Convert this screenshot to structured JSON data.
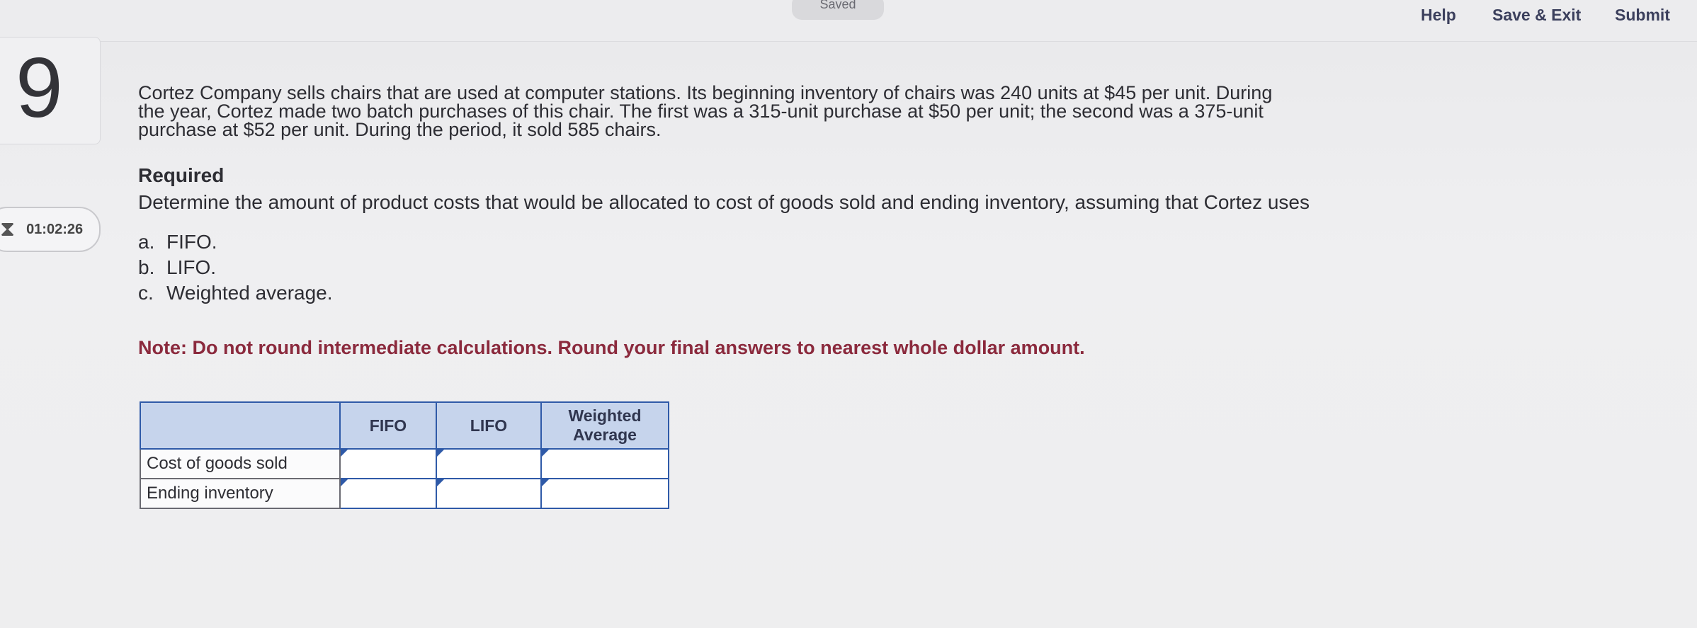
{
  "topbar": {
    "saved_label": "Saved",
    "help_label": "Help",
    "save_exit_label": "Save & Exit",
    "submit_label": "Submit"
  },
  "question": {
    "number": "9",
    "timer": "01:02:26",
    "prompt_lines": [
      "Cortez Company sells chairs that are used at computer stations. Its beginning inventory of chairs was 240 units at $45 per unit. During",
      "the year, Cortez made two batch purchases of this chair. The first was a 315-unit purchase at $50 per unit; the second was a 375-unit",
      "purchase at $52 per unit. During the period, it sold 585 chairs."
    ],
    "required_title": "Required",
    "required_text": "Determine the amount of product costs that would be allocated to cost of goods sold and ending inventory, assuming that Cortez uses",
    "options": [
      {
        "letter": "a.",
        "text": "FIFO."
      },
      {
        "letter": "b.",
        "text": "LIFO."
      },
      {
        "letter": "c.",
        "text": "Weighted average."
      }
    ],
    "note": "Note: Do not round intermediate calculations. Round your final answers to nearest whole dollar amount."
  },
  "answer_table": {
    "headers": [
      "",
      "FIFO",
      "LIFO",
      "Weighted Average"
    ],
    "rows": [
      {
        "label": "Cost of goods sold",
        "values": [
          "",
          "",
          ""
        ]
      },
      {
        "label": "Ending inventory",
        "values": [
          "",
          "",
          ""
        ]
      }
    ]
  },
  "icons": {
    "timer": "hourglass-icon"
  }
}
